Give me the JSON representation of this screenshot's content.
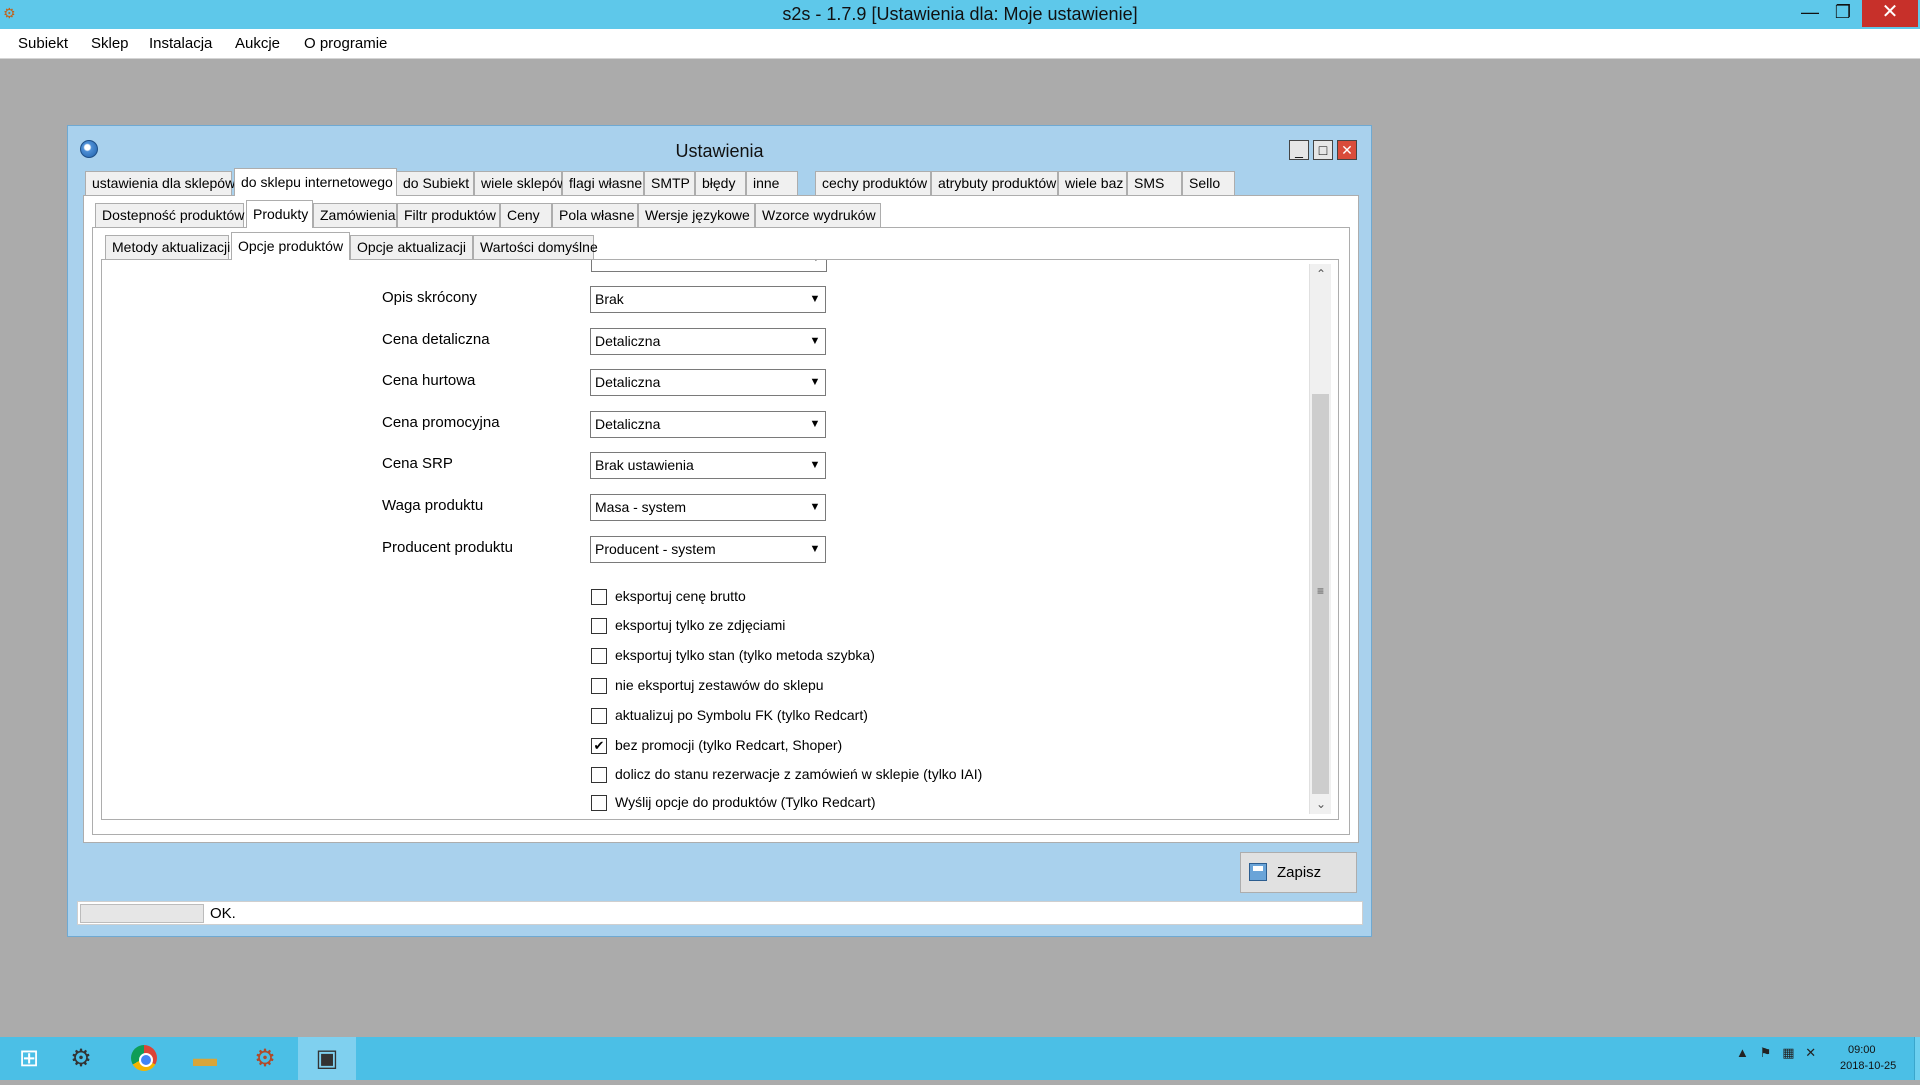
{
  "app": {
    "title": "s2s - 1.7.9 [Ustawienia dla: Moje ustawienie]",
    "icon": "s2s-app-icon"
  },
  "menu": [
    "Subiekt",
    "Sklep",
    "Instalacja",
    "Aukcje",
    "O programie"
  ],
  "dialog": {
    "title": "Ustawienia",
    "tabs_level1": [
      "ustawienia dla sklepów",
      "do sklepu internetowego",
      "do Subiekt",
      "wiele sklepów",
      "flagi własne",
      "SMTP",
      "błędy",
      "inne",
      "cechy produktów",
      "atrybuty produktów",
      "wiele baz",
      "SMS",
      "Sello"
    ],
    "tabs_level1_selected": "do sklepu internetowego",
    "tabs_level2": [
      "Dostepność produktów",
      "Produkty",
      "Zamówienia",
      "Filtr produktów",
      "Ceny",
      "Pola własne",
      "Wersje językowe",
      "Wzorce wydruków"
    ],
    "tabs_level2_selected": "Produkty",
    "tabs_level3": [
      "Metody aktualizacji",
      "Opcje produktów",
      "Opcje aktualizacji",
      "Wartości domyślne"
    ],
    "tabs_level3_selected": "Opcje produktów",
    "form": {
      "rows": [
        {
          "label": "Opis skrócony",
          "value": "Brak"
        },
        {
          "label": "Cena detaliczna",
          "value": "Detaliczna"
        },
        {
          "label": "Cena hurtowa",
          "value": "Detaliczna"
        },
        {
          "label": "Cena promocyjna",
          "value": "Detaliczna"
        },
        {
          "label": "Cena SRP",
          "value": "Brak ustawienia"
        },
        {
          "label": "Waga produktu",
          "value": "Masa - system"
        },
        {
          "label": "Producent produktu",
          "value": "Producent - system"
        }
      ],
      "checkboxes": [
        {
          "label": "eksportuj cenę brutto",
          "checked": false
        },
        {
          "label": "eksportuj  tylko ze zdjęciami",
          "checked": false
        },
        {
          "label": "eksportuj  tylko stan (tylko metoda szybka)",
          "checked": false
        },
        {
          "label": "nie eksportuj zestawów do sklepu",
          "checked": false
        },
        {
          "label": "aktualizuj po Symbolu FK (tylko Redcart)",
          "checked": false
        },
        {
          "label": "bez promocji (tylko Redcart, Shoper)",
          "checked": true
        },
        {
          "label": "dolicz do stanu  rezerwacje z zamówień w sklepie (tylko IAI)",
          "checked": false
        },
        {
          "label": "Wyślij opcje do produktów (Tylko Redcart)",
          "checked": false
        }
      ]
    },
    "save_label": "Zapisz",
    "status_text": "OK."
  },
  "taskbar": {
    "time": "09:00",
    "date": "2018-10-25"
  }
}
